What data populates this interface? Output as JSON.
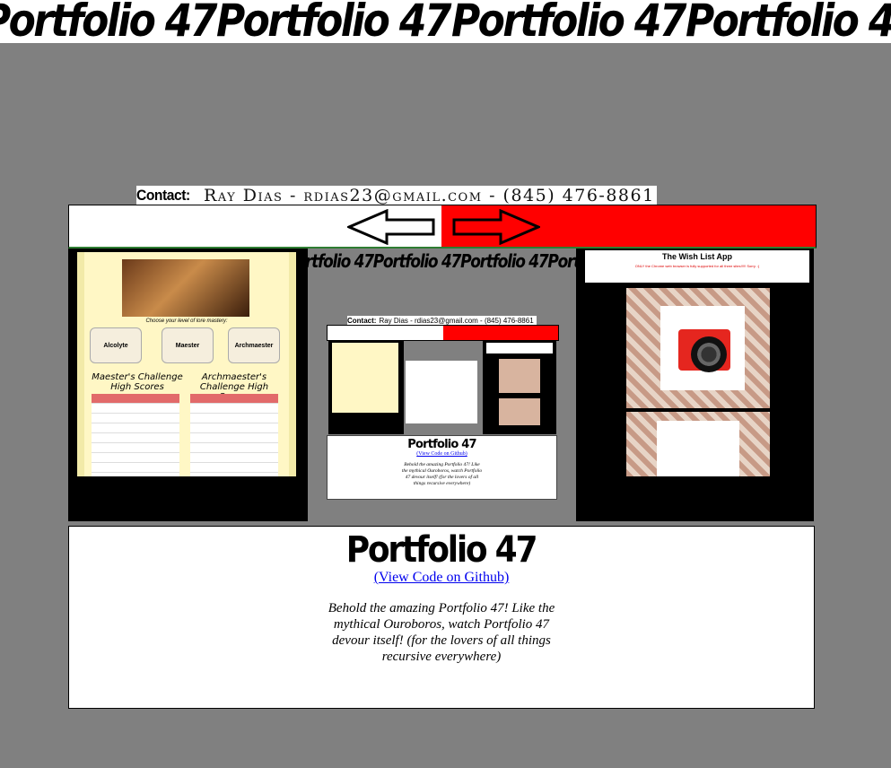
{
  "banner": {
    "text": "Portfolio 47"
  },
  "contact": {
    "label": "Contact:",
    "info": "Ray Dias - rdias23@gmail.com - (845) 476-8861"
  },
  "nav": {
    "prev_icon": "arrow-left-icon",
    "next_icon": "arrow-right-icon",
    "colors": {
      "left": "#ffffff",
      "right": "#ff0000"
    }
  },
  "stage": {
    "mini_marquee": "rtfolio 47Portfolio 47Portfolio 47Portfolio",
    "trivia": {
      "caption": "Choose your level of lore mastery:",
      "levels": [
        "Alcolyte",
        "Maester",
        "Archmaester"
      ],
      "left_heading": "Maester's Challenge High Scores",
      "right_heading": "Archmaester's Challenge High Scores"
    },
    "wishlist": {
      "title": "The Wish List App",
      "warning": "ONLY the Chrome web browser is fully supported for all three sites!!!!! Sorry. :("
    },
    "mini_card": {
      "contact_label": "Contact:",
      "contact_info": "Ray Dias - rdias23@gmail.com - (845) 476-8861",
      "title": "Portfolio 47",
      "link": "(View Code on Github)",
      "description": "Behold the amazing Portfolio 47! Like the mythical Ouroboros, watch Portfolio 47 devour itself! (for the lovers of all things recursive everywhere)"
    }
  },
  "card": {
    "title": "Portfolio 47",
    "link": "(View Code on Github)",
    "description": "Behold the amazing Portfolio 47! Like the mythical Ouroboros, watch Portfolio 47 devour itself! (for the lovers of all things recursive everywhere)"
  }
}
